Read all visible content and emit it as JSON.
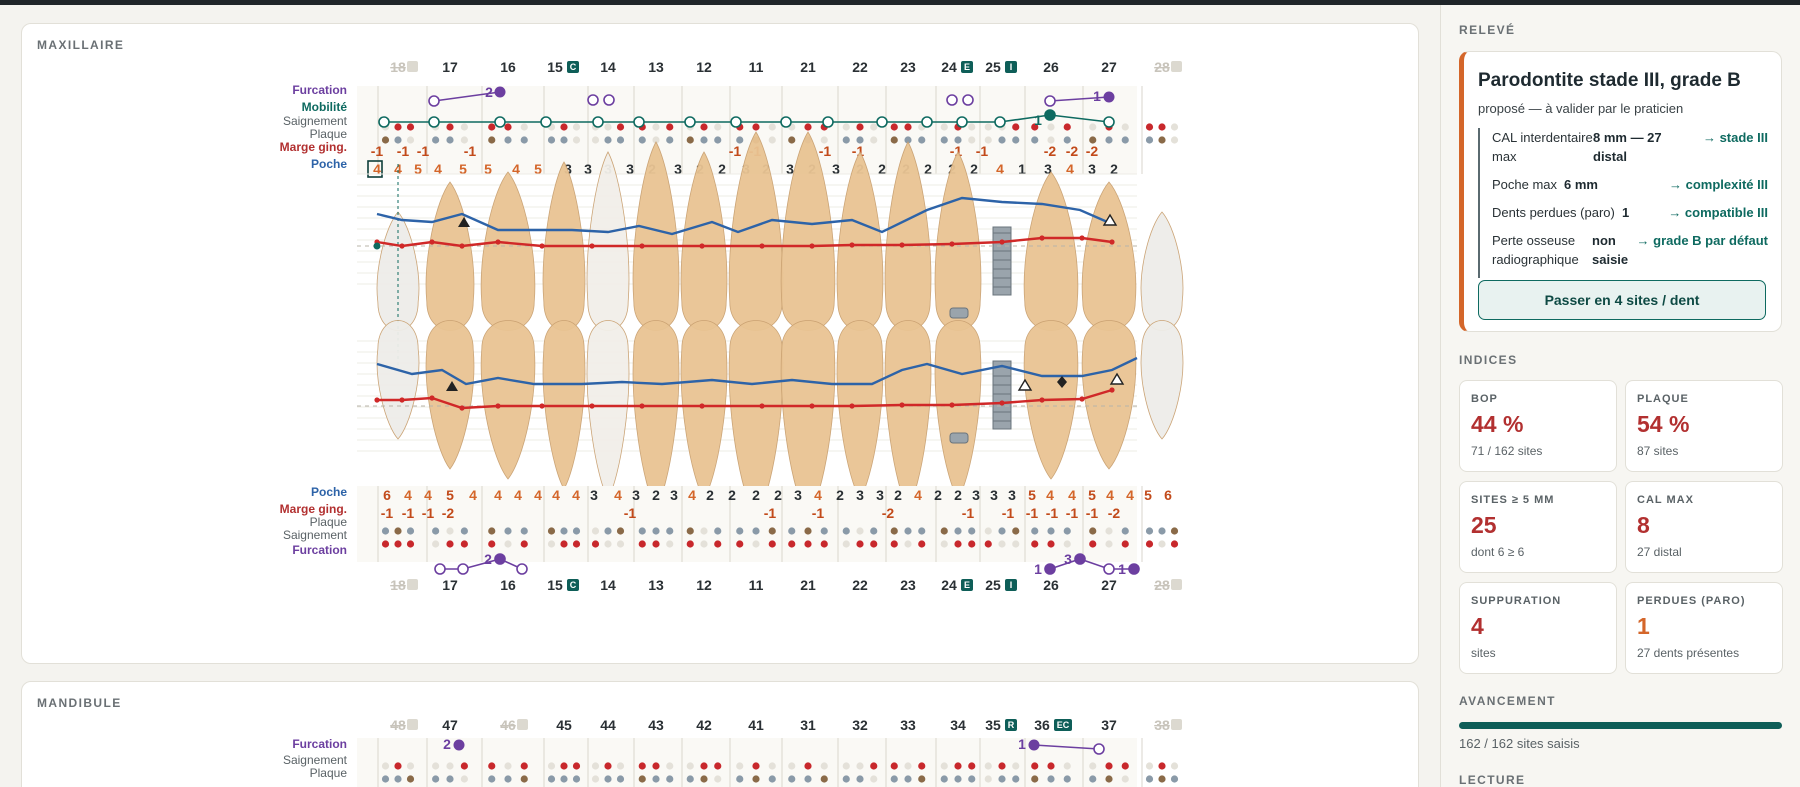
{
  "maxillaire": {
    "title": "MAXILLAIRE",
    "rows_top": {
      "furcation": "Furcation",
      "mobilite": "Mobilité",
      "saignement": "Saignement",
      "plaque": "Plaque",
      "marge": "Marge ging.",
      "poche": "Poche"
    },
    "rows_bottom": {
      "poche": "Poche",
      "marge": "Marge ging.",
      "plaque": "Plaque",
      "saignement": "Saignement",
      "furcation": "Furcation"
    },
    "teeth": [
      {
        "n": "18",
        "missing": true
      },
      {
        "n": "17"
      },
      {
        "n": "16"
      },
      {
        "n": "15",
        "badge": "C"
      },
      {
        "n": "14"
      },
      {
        "n": "13"
      },
      {
        "n": "12"
      },
      {
        "n": "11"
      },
      {
        "n": "21"
      },
      {
        "n": "22"
      },
      {
        "n": "23"
      },
      {
        "n": "24",
        "badge": "E"
      },
      {
        "n": "25",
        "badge": "I"
      },
      {
        "n": "26"
      },
      {
        "n": "27"
      },
      {
        "n": "28",
        "missing": true
      }
    ],
    "poche_top": [
      "4",
      "4",
      "5",
      "4",
      "5",
      "5",
      "4",
      "5",
      "3",
      "3",
      "3",
      "3",
      "2",
      "3",
      "2",
      "2",
      "3",
      "2",
      "3",
      "2",
      "3",
      "2",
      "2",
      "2",
      "2",
      "2",
      "2",
      "4",
      "1",
      "3",
      "4",
      "3",
      "2",
      "4",
      "3",
      "4",
      "3",
      "3",
      "4",
      "5",
      "5",
      "5",
      "3",
      "4"
    ],
    "marge_top": [
      "-1",
      "-1",
      "-1",
      "-1",
      "-1",
      "-1",
      "-1",
      "-1",
      "-1",
      "-1",
      "-2",
      "-2",
      "-2"
    ],
    "furcation_top": [
      "2",
      "1"
    ],
    "mobilite_top": [
      "1"
    ],
    "poche_bottom": [
      "6",
      "4",
      "4",
      "5",
      "4",
      "4",
      "4",
      "4",
      "4",
      "4",
      "3",
      "4",
      "3",
      "2",
      "3",
      "4",
      "2",
      "2",
      "2",
      "2",
      "3",
      "4",
      "2",
      "3",
      "3",
      "2",
      "4",
      "2",
      "2",
      "3",
      "3",
      "3",
      "5",
      "4",
      "4",
      "5",
      "4",
      "4",
      "5",
      "6",
      "4",
      "6"
    ],
    "marge_bottom": [
      "-1",
      "-1",
      "-1",
      "-2",
      "-1",
      "-1",
      "-1",
      "-2",
      "-1",
      "-1",
      "-1",
      "-1",
      "-1",
      "-1",
      "-2"
    ],
    "furcation_bottom": [
      "2",
      "1",
      "3",
      "1"
    ]
  },
  "mandibule": {
    "title": "MANDIBULE",
    "rows": {
      "furcation": "Furcation",
      "saignement": "Saignement",
      "plaque": "Plaque"
    },
    "teeth": [
      {
        "n": "48",
        "missing": true
      },
      {
        "n": "47"
      },
      {
        "n": "46",
        "missing": true
      },
      {
        "n": "45"
      },
      {
        "n": "44"
      },
      {
        "n": "43"
      },
      {
        "n": "42"
      },
      {
        "n": "41"
      },
      {
        "n": "31"
      },
      {
        "n": "32"
      },
      {
        "n": "33"
      },
      {
        "n": "34"
      },
      {
        "n": "35",
        "badge": "R"
      },
      {
        "n": "36",
        "badge": "EC"
      },
      {
        "n": "37"
      },
      {
        "n": "38",
        "missing": true
      }
    ],
    "furcation": [
      "2",
      "1"
    ]
  },
  "sidebar": {
    "releve_title": "RELEVÉ",
    "diagnosis": {
      "title": "Parodontite stade III, grade B",
      "subtitle": "proposé — à valider par le praticien",
      "criteria": [
        {
          "label": "CAL interdentaire max",
          "value": "8 mm — 27 distal",
          "result": "→ stade III"
        },
        {
          "label": "Poche max",
          "value": "6 mm",
          "result": "→ complexité III"
        },
        {
          "label": "Dents perdues (paro)",
          "value": "1",
          "result": "→ compatible III"
        },
        {
          "label": "Perte osseuse radiographique",
          "value": "non saisie",
          "result": "→ grade B par défaut"
        }
      ],
      "button": "Passer en 4 sites / dent"
    },
    "indices_title": "INDICES",
    "indices": [
      {
        "label": "BOP",
        "value": "44 %",
        "sub": "71 / 162 sites"
      },
      {
        "label": "PLAQUE",
        "value": "54 %",
        "sub": "87 sites"
      },
      {
        "label": "SITES ≥ 5 MM",
        "value": "25",
        "sub": "dont 6 ≥ 6"
      },
      {
        "label": "CAL MAX",
        "value": "8",
        "sub": "27 distal"
      },
      {
        "label": "SUPPURATION",
        "value": "4",
        "sub": "sites"
      },
      {
        "label": "PERDUES (PARO)",
        "value": "1",
        "sub": "27 dents présentes"
      }
    ],
    "avancement_title": "AVANCEMENT",
    "progress": 1.0,
    "progress_text": "162 / 162 sites saisis",
    "lecture_title": "LECTURE"
  },
  "colors": {
    "accent": "#0e6a60",
    "orange": "#d4662a",
    "red": "#b23030",
    "blue": "#2d63a8",
    "purple": "#6c3fa0"
  }
}
